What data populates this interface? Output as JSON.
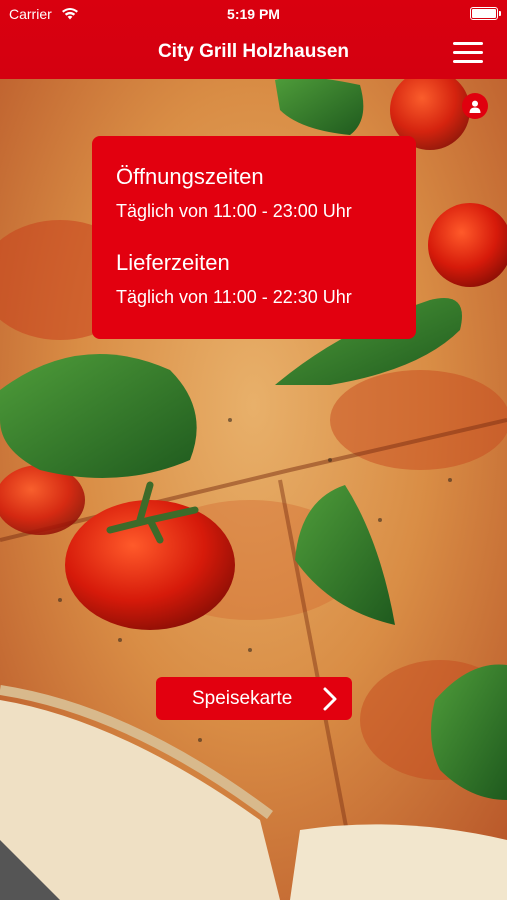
{
  "status_bar": {
    "carrier": "Carrier",
    "time": "5:19 PM",
    "wifi_icon": "wifi-icon",
    "battery_icon": "battery-icon"
  },
  "nav": {
    "title": "City Grill Holzhausen",
    "menu_icon": "hamburger-menu-icon"
  },
  "account": {
    "icon": "user-icon"
  },
  "hours": {
    "opening_title": "Öffnungszeiten",
    "opening_text": "Täglich von 11:00 - 23:00 Uhr",
    "delivery_title": "Lieferzeiten",
    "delivery_text": "Täglich von 11:00 - 22:30 Uhr"
  },
  "menu_button": {
    "label": "Speisekarte",
    "icon": "chevron-right-icon"
  },
  "colors": {
    "brand_red": "#e2000f",
    "text_on_brand": "#ffffff"
  }
}
